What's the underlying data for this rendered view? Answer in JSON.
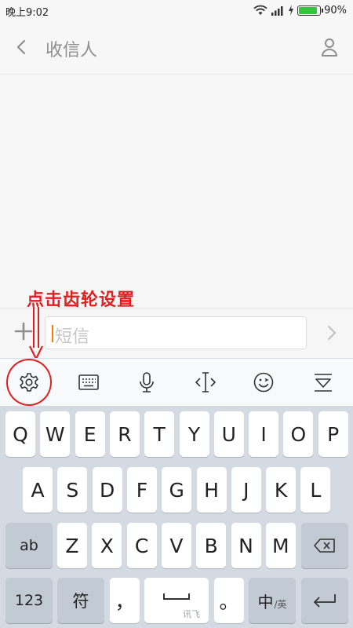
{
  "status_bar": {
    "time": "晚上9:02",
    "battery_percent_text": "90%",
    "battery_level": 0.9,
    "icons": [
      "wifi-icon",
      "signal-icon",
      "charging-icon",
      "battery-icon"
    ]
  },
  "header": {
    "title": "收信人",
    "back_icon": "chevron-left-icon",
    "contact_icon": "person-icon"
  },
  "annotation": {
    "text": "点击齿轮设置",
    "color": "#e02020"
  },
  "composer": {
    "placeholder": "短信",
    "add_icon": "plus-icon",
    "send_icon": "chevron-right-icon",
    "caret_color": "#ff7a00"
  },
  "keyboard_toolbar": {
    "icons": [
      "gear-icon",
      "keyboard-icon",
      "microphone-icon",
      "text-cursor-icon",
      "emoji-icon",
      "collapse-keyboard-icon"
    ]
  },
  "keyboard": {
    "row1": [
      "Q",
      "W",
      "E",
      "R",
      "T",
      "Y",
      "U",
      "I",
      "O",
      "P"
    ],
    "row2": [
      "A",
      "S",
      "D",
      "F",
      "G",
      "H",
      "J",
      "K",
      "L"
    ],
    "row3_left": "ab",
    "row3": [
      "Z",
      "X",
      "C",
      "V",
      "B",
      "N",
      "M"
    ],
    "row4": {
      "num": "123",
      "symbol": "符",
      "comma": "，",
      "space_brand": "讯飞",
      "period": "。",
      "lang_main": "中",
      "lang_sub": "/英"
    },
    "icons": [
      "backspace-icon",
      "space-icon",
      "enter-icon"
    ]
  }
}
